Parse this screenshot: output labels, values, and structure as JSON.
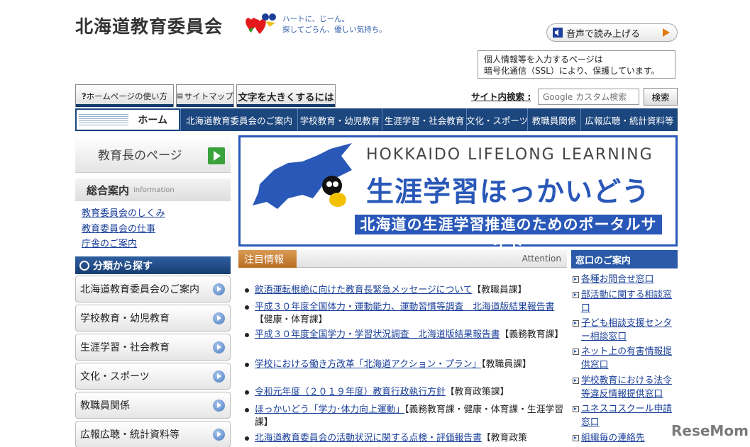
{
  "header": {
    "title": "北海道教育委員会",
    "tagline_1": "ハートに、じーん。",
    "tagline_2": "探してごらん、優しい気持ち。",
    "tts_label": "音声で読み上げる",
    "ssl_line1": "個人情報等を入力するページは",
    "ssl_line2": "暗号化通信（SSL）により、保護しています。"
  },
  "utility": {
    "usage": "ホームページの使い方",
    "sitemap": "サイトマップ",
    "fontsize": "文字を大きくするには"
  },
  "search": {
    "label": "サイト内検索",
    "placeholder": "Google カスタム検索",
    "button": "検索"
  },
  "nav": {
    "home": "ホーム",
    "items": [
      "北海道教育委員会のご案内",
      "学校教育・幼児教育",
      "生涯学習・社会教育",
      "文化・スポーツ",
      "教職員関係",
      "広報広聴・統計資料等"
    ]
  },
  "left": {
    "superintendent": "教育長のページ",
    "info_jp": "総合案内",
    "info_en": "information",
    "info_links": [
      "教育委員会のしくみ",
      "教育委員会の仕事",
      "庁舎のご案内"
    ],
    "category_head": "分類から探す",
    "categories": [
      "北海道教育委員会のご案内",
      "学校教育・幼児教育",
      "生涯学習・社会教育",
      "文化・スポーツ",
      "教職員関係",
      "広報広聴・統計資料等"
    ]
  },
  "banner": {
    "en": "HOKKAIDO LIFELONG LEARNING",
    "jp": "生涯学習ほっかいどう",
    "sub": "北海道の生涯学習推進のためのポータルサイト"
  },
  "attention": {
    "title": "注目情報",
    "en": "Attention",
    "items": [
      {
        "link": "飲酒運転根絶に向けた教育長緊急メッセージについて",
        "cat": "【教職員課】"
      },
      {
        "link": "平成３０年度全国体力・運動能力、運動習慣等調査　北海道版結果報告書",
        "cat": "【健康・体育課】"
      },
      {
        "link": "平成３０年度全国学力・学習状況調査　北海道版結果報告書",
        "cat": "【義務教育課】"
      },
      {
        "link": "学校における働き方改革「北海道アクション・プラン」",
        "cat": "【教職員課】"
      },
      {
        "link": "令和元年度（２０１９年度）教育行政執行方針",
        "cat": "【教育政策課】"
      },
      {
        "link": "ほっかいどう「学力･体力向上運動」",
        "cat": "【義務教育課・健康・体育課・生涯学習課】"
      },
      {
        "link": "北海道教育委員会の活動状況に関する点検・評価報告書",
        "cat": "【教育政策"
      }
    ]
  },
  "window": {
    "title": "窓口のご案内",
    "items": [
      "各種お問合せ窓口",
      "部活動に関する相談窓口",
      "子ども相談支援センター相談窓口",
      "ネット上の有害情報提供窓口",
      "学校教育における法令等違反情報提供窓口",
      "ユネスコスクール申請窓口",
      "組織毎の連絡先"
    ]
  },
  "watermark": "ReseMom",
  "colors": {
    "nav": "#1c467e",
    "accent": "#2a58b8",
    "attention_tab": "#c27a30"
  }
}
